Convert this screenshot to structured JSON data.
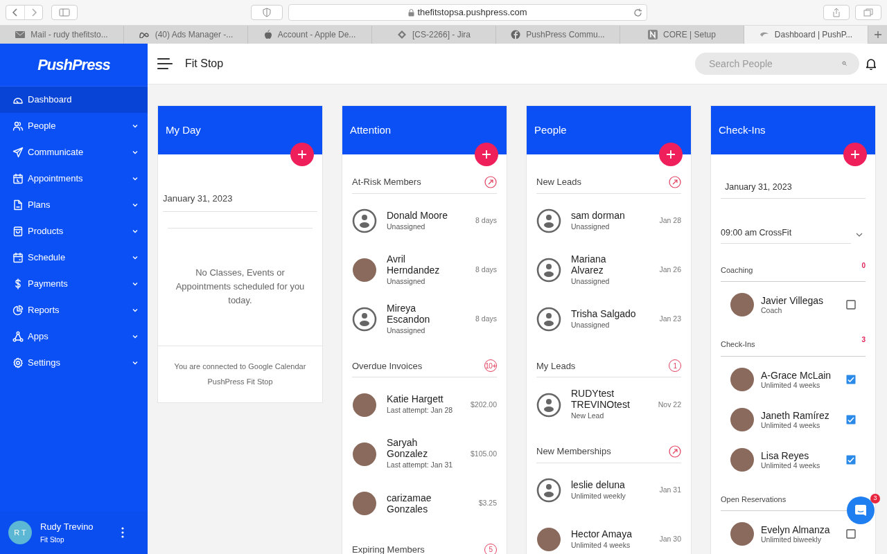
{
  "browser": {
    "url": "thefitstopsa.pushpress.com",
    "tabs": [
      {
        "label": "Mail - rudy thefitsto...",
        "selected": false
      },
      {
        "label": "(40) Ads Manager -...",
        "selected": false
      },
      {
        "label": "Account - Apple De...",
        "selected": false
      },
      {
        "label": "[CS-2266] - Jira",
        "selected": false
      },
      {
        "label": "PushPress Commu...",
        "selected": false
      },
      {
        "label": "CORE | Setup",
        "selected": false
      },
      {
        "label": "Dashboard | PushP...",
        "selected": true
      }
    ]
  },
  "sidebar": {
    "logo": "PushPress",
    "items": [
      {
        "label": "Dashboard",
        "selected": true,
        "expandable": false
      },
      {
        "label": "People",
        "selected": false,
        "expandable": true
      },
      {
        "label": "Communicate",
        "selected": false,
        "expandable": true
      },
      {
        "label": "Appointments",
        "selected": false,
        "expandable": true
      },
      {
        "label": "Plans",
        "selected": false,
        "expandable": true
      },
      {
        "label": "Products",
        "selected": false,
        "expandable": true
      },
      {
        "label": "Schedule",
        "selected": false,
        "expandable": true
      },
      {
        "label": "Payments",
        "selected": false,
        "expandable": true
      },
      {
        "label": "Reports",
        "selected": false,
        "expandable": true
      },
      {
        "label": "Apps",
        "selected": false,
        "expandable": true
      },
      {
        "label": "Settings",
        "selected": false,
        "expandable": true
      }
    ],
    "user": {
      "initials": "R T",
      "name": "Rudy Trevino",
      "org": "Fit Stop"
    }
  },
  "header": {
    "title": "Fit Stop",
    "search": {
      "placeholder": "Search People"
    }
  },
  "my_day": {
    "title": "My Day",
    "date": "January 31, 2023",
    "empty_message": "No Classes, Events or Appointments scheduled for you today.",
    "footer_lines": [
      "You are connected to Google Calendar",
      "PushPress Fit Stop"
    ]
  },
  "attention": {
    "title": "Attention",
    "sections": [
      {
        "title": "At-Risk Members",
        "badge": {
          "kind": "link"
        },
        "rows": [
          {
            "name": "Donald Moore",
            "sub": "Unassigned",
            "right": "8 days",
            "has_photo": false
          },
          {
            "name": "Avril Herndandez",
            "sub": "Unassigned",
            "right": "8 days",
            "has_photo": true
          },
          {
            "name": "Mireya Escandon",
            "sub": "Unassigned",
            "right": "8 days",
            "has_photo": false
          }
        ]
      },
      {
        "title": "Overdue Invoices",
        "badge": {
          "kind": "count",
          "text": "10+"
        },
        "rows": [
          {
            "name": "Katie Hargett",
            "sub": "Last attempt: Jan 28",
            "right": "$202.00",
            "has_photo": true
          },
          {
            "name": "Saryah Gonzalez",
            "sub": "Last attempt: Jan 31",
            "right": "$105.00",
            "has_photo": true
          },
          {
            "name": "carizamae Gonzales",
            "right": "$3.25",
            "has_photo": true
          }
        ]
      },
      {
        "title": "Expiring Members",
        "badge": {
          "kind": "count",
          "text": "5"
        }
      }
    ]
  },
  "people": {
    "title": "People",
    "sections": [
      {
        "title": "New Leads",
        "badge": {
          "kind": "link"
        },
        "rows": [
          {
            "name": "sam dorman",
            "sub": "Unassigned",
            "right": "Jan 28",
            "has_photo": false
          },
          {
            "name": "Mariana Alvarez",
            "sub": "Unassigned",
            "right": "Jan 26",
            "has_photo": false
          },
          {
            "name": "Trisha Salgado",
            "sub": "Unassigned",
            "right": "Jan 23",
            "has_photo": false
          }
        ]
      },
      {
        "title": "My Leads",
        "badge": {
          "kind": "count",
          "text": "1"
        },
        "rows": [
          {
            "name": "RUDYtest TREVINOtest",
            "sub": "New Lead",
            "right": "Nov 22",
            "has_photo": false
          }
        ]
      },
      {
        "title": "New Memberships",
        "badge": {
          "kind": "link"
        },
        "rows": [
          {
            "name": "leslie deluna",
            "sub": "Unlimited weekly",
            "right": "Jan 31",
            "has_photo": false
          },
          {
            "name": "Hector Amaya",
            "sub": "Unlimited 4 weeks",
            "right": "Jan 30",
            "has_photo": true
          }
        ]
      }
    ]
  },
  "checkins": {
    "title": "Check-Ins",
    "date": "January 31, 2023",
    "class_select": "09:00 am CrossFit",
    "groups": [
      {
        "title": "Coaching",
        "count": "0",
        "rows": [
          {
            "name": "Javier Villegas",
            "sub": "Coach",
            "checked": false
          }
        ]
      },
      {
        "title": "Check-Ins",
        "count": "3",
        "rows": [
          {
            "name": "A-Grace McLain",
            "sub": "Unlimited 4 weeks",
            "checked": true
          },
          {
            "name": "Janeth Ramírez",
            "sub": "Unlimited 4 weeks",
            "checked": true
          },
          {
            "name": "Lisa Reyes",
            "sub": "Unlimited 4 weeks",
            "checked": true
          }
        ]
      },
      {
        "title": "Open Reservations",
        "rows": [
          {
            "name": "Evelyn Almanza",
            "sub": "Unlimited biweekly",
            "checked": false
          }
        ]
      }
    ]
  },
  "chat": {
    "unread": "3"
  }
}
